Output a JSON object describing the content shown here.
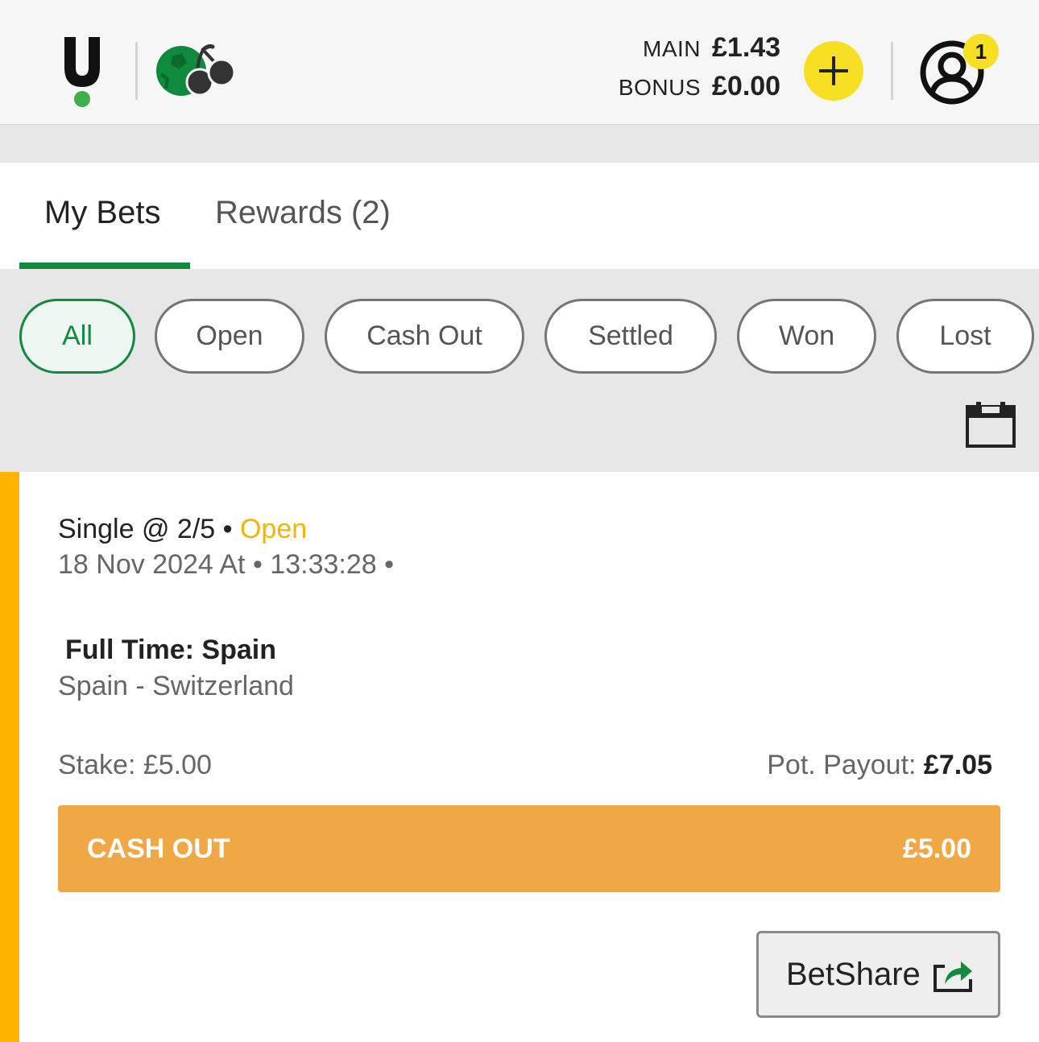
{
  "header": {
    "balances": [
      {
        "label": "MAIN",
        "value": "£1.43"
      },
      {
        "label": "BONUS",
        "value": "£0.00"
      }
    ],
    "notification_count": "1",
    "colors": {
      "brand_green": "#108a3c",
      "deposit_yellow": "#f7e024"
    }
  },
  "tabs": [
    {
      "label": "My Bets",
      "active": true
    },
    {
      "label": "Rewards (2)",
      "active": false
    }
  ],
  "filters": [
    {
      "label": "All",
      "active": true
    },
    {
      "label": "Open",
      "active": false
    },
    {
      "label": "Cash Out",
      "active": false
    },
    {
      "label": "Settled",
      "active": false
    },
    {
      "label": "Won",
      "active": false
    },
    {
      "label": "Lost",
      "active": false
    }
  ],
  "bet": {
    "type": "Single @ 2/5",
    "separator": " • ",
    "status": "Open",
    "date_line": "18 Nov 2024 At • 13:33:28 •",
    "selection": "Full Time: Spain",
    "event": "Spain - Switzerland",
    "stake": "Stake: £5.00",
    "payout_label": "Pot. Payout: ",
    "payout_value": "£7.05",
    "cashout_label": "CASH OUT",
    "cashout_value": "£5.00",
    "betshare_label": "BetShare",
    "colors": {
      "status_open": "#f2b500",
      "cashout": "#f0a845",
      "card_bar": "#ffb400"
    }
  }
}
